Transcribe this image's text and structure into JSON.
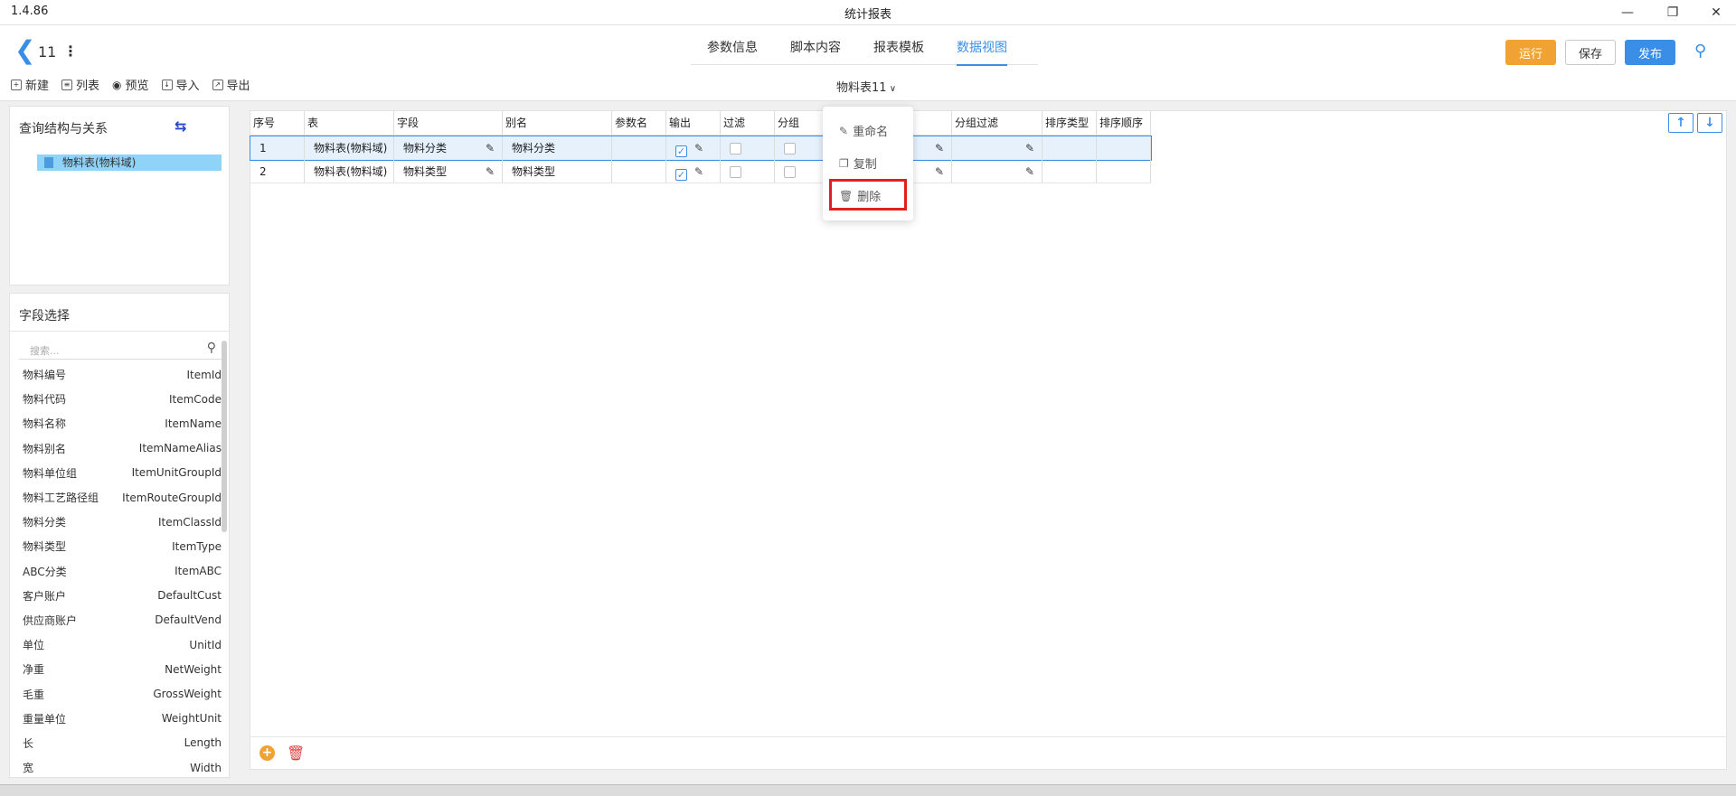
{
  "app": {
    "version": "1.4.86",
    "window_title": "统计报表"
  },
  "header": {
    "page_number": "11",
    "tabs": [
      {
        "label": "参数信息"
      },
      {
        "label": "脚本内容"
      },
      {
        "label": "报表模板"
      },
      {
        "label": "数据视图"
      }
    ],
    "active_tab": "数据视图",
    "buttons": {
      "run": "运行",
      "save": "保存",
      "publish": "发布"
    }
  },
  "toolbar": {
    "new": "新建",
    "list": "列表",
    "preview": "预览",
    "import": "导入",
    "export": "导出"
  },
  "table_selector": "物料表11",
  "query_panel": {
    "title": "查询结构与关系",
    "tree_item": "物料表(物料域)"
  },
  "field_panel": {
    "title": "字段选择",
    "search_placeholder": "搜索...",
    "fields": [
      {
        "cn": "物料编号",
        "en": "ItemId"
      },
      {
        "cn": "物料代码",
        "en": "ItemCode"
      },
      {
        "cn": "物料名称",
        "en": "ItemName"
      },
      {
        "cn": "物料别名",
        "en": "ItemNameAlias"
      },
      {
        "cn": "物料单位组",
        "en": "ItemUnitGroupId"
      },
      {
        "cn": "物料工艺路径组",
        "en": "ItemRouteGroupId"
      },
      {
        "cn": "物料分类",
        "en": "ItemClassId"
      },
      {
        "cn": "物料类型",
        "en": "ItemType"
      },
      {
        "cn": "ABC分类",
        "en": "ItemABC"
      },
      {
        "cn": "客户账户",
        "en": "DefaultCust"
      },
      {
        "cn": "供应商账户",
        "en": "DefaultVend"
      },
      {
        "cn": "单位",
        "en": "UnitId"
      },
      {
        "cn": "净重",
        "en": "NetWeight"
      },
      {
        "cn": "毛重",
        "en": "GrossWeight"
      },
      {
        "cn": "重量单位",
        "en": "WeightUnit"
      },
      {
        "cn": "长",
        "en": "Length"
      },
      {
        "cn": "宽",
        "en": "Width"
      }
    ]
  },
  "grid": {
    "columns": [
      "序号",
      "表",
      "字段",
      "别名",
      "参数名",
      "输出",
      "过滤",
      "分组",
      "",
      "分组过滤",
      "排序类型",
      "排序顺序"
    ],
    "rows": [
      {
        "no": "1",
        "table": "物料表(物料域)",
        "field": "物料分类",
        "alias": "物料分类",
        "param": "",
        "output": true,
        "filter": false,
        "group": false
      },
      {
        "no": "2",
        "table": "物料表(物料域)",
        "field": "物料类型",
        "alias": "物料类型",
        "param": "",
        "output": true,
        "filter": false,
        "group": false
      }
    ]
  },
  "context_menu": {
    "rename": "重命名",
    "copy": "复制",
    "delete": "删除"
  },
  "colors": {
    "accent": "#3a8ee6",
    "run": "#f0a232",
    "highlight": "#e02020",
    "selection": "#8fd3f7"
  }
}
